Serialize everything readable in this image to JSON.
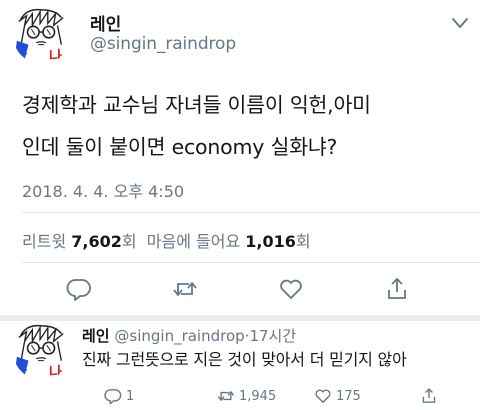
{
  "tweet": {
    "display_name": "레인",
    "handle": "@singin_raindrop",
    "text_line1": "경제학과 교수님 자녀들 이름이 익헌,아미",
    "text_line2": "인데 둘이 붙이면 economy 실화냐?",
    "timestamp": "2018. 4. 4. 오후 4:50",
    "stats": {
      "retweet_label": "리트윗",
      "retweet_count": "7,602",
      "retweet_unit": "회",
      "like_label": "마음에 들어요",
      "like_count": "1,016",
      "like_unit": "회"
    },
    "actions": [
      "reply-icon",
      "retweet-icon",
      "like-icon",
      "share-icon"
    ]
  },
  "avatar": {
    "label": "나",
    "icon": "avatar-drawing-icon"
  },
  "reply": {
    "display_name": "레인",
    "handle": "@singin_raindrop",
    "separator": "·",
    "time": "17시간",
    "text": "진짜 그런뜻으로 지은 것이 맞아서 더 믿기지 않아",
    "reply_count": "1",
    "retweet_count": "1,945",
    "like_count": "175"
  },
  "colors": {
    "text": "#14171a",
    "secondary": "#657786",
    "divider": "#e1e8ed",
    "section_divider": "#e6ecf0",
    "avatar_blue": "#1f4fd6",
    "avatar_red": "#d0211c"
  }
}
